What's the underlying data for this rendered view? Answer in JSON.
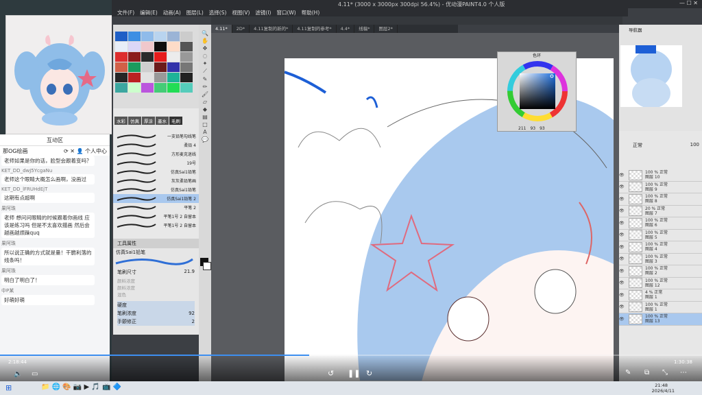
{
  "window_title": "4.11* (3000 x 3000px 300dpi 56.4%)  - 优动漫PAINT4.0 个人版",
  "menu": [
    "文件(F)",
    "编辑(E)",
    "动画(A)",
    "图层(L)",
    "选择(S)",
    "视图(V)",
    "滤镜(I)",
    "窗口(W)",
    "帮助(H)"
  ],
  "doc_tabs": [
    "4.11*",
    "2D*",
    "4.11复制的新的*",
    "4.11复制的参考*",
    "4.4*",
    "线稿*",
    "图层2*"
  ],
  "chat": {
    "title": "互动区",
    "channel": "那OG绘画",
    "personal_center": "个人中心",
    "messages": [
      {
        "user": "",
        "text": "老师如果是你的话，脸型会跟着变吗？"
      },
      {
        "user": "KET_DD_dwJ5YcgaNu",
        "text": "老师这个眼睛大概怎么画啊，没画过"
      },
      {
        "user": "KET_DD_lFRUHdEjT",
        "text": "这期有点超啊"
      },
      {
        "user": "果阿珠",
        "text": "老师 想问问眼睛的时候跟着你画线 应该是练习吗 但是不太喜欢描画 然后会越画越烦躁quq"
      },
      {
        "user": "果阿珠",
        "text": "所以说正确的方式就是量！干脆利落的线条吗！"
      },
      {
        "user": "果阿珠",
        "text": "明白了明白了！"
      },
      {
        "user": "中P某",
        "text": "好萌好萌"
      }
    ]
  },
  "subtool": {
    "tabs": [
      "水彩",
      "仿真",
      "厚涂",
      "墨水",
      "毛刷"
    ],
    "header": "一般铅笔GB",
    "brushes": [
      "一支铅笔勾线笔",
      "柔铅 4",
      "方形麦克迷线",
      "19号",
      "仿真Sai1铅笔",
      "灰灰柔铅笔画",
      "仿真Sai1铅笔",
      "仿真Sai1铅笔 2",
      "平笔 2",
      "平笔1号 2 自留本",
      "平笔1号 2 自留本"
    ]
  },
  "tool_property": {
    "title": "工具属性",
    "brush": "仿真Sai1铅笔",
    "brush_size_label": "笔刷尺寸",
    "brush_size": "21.9",
    "rows": [
      "颜料浓度",
      "颜料浓度",
      "混色",
      "硬度",
      "笔刷浓度",
      "手颤修正"
    ],
    "brush_density": "92",
    "stabilization": "2"
  },
  "color_wheel": {
    "title": "色环",
    "h": "211",
    "s": "93",
    "v": "93"
  },
  "nav_title": "导航器",
  "layers": {
    "blend": "正常",
    "opacity": "100",
    "rows": [
      {
        "label": "100 % 正常",
        "name": "图层 10"
      },
      {
        "label": "100 % 正常",
        "name": "图层 9"
      },
      {
        "label": "100 % 正常",
        "name": "图层 8"
      },
      {
        "label": "20 % 正常",
        "name": "图层 7"
      },
      {
        "label": "100 % 正常",
        "name": "图层 6"
      },
      {
        "label": "100 % 正常",
        "name": "图层 5"
      },
      {
        "label": "100 % 正常",
        "name": "图层 4"
      },
      {
        "label": "100 % 正常",
        "name": "图层 3"
      },
      {
        "label": "100 % 正常",
        "name": "图层 2"
      },
      {
        "label": "100 % 正常",
        "name": "图层 12"
      },
      {
        "label": "4 % 正常",
        "name": "图层 1"
      },
      {
        "label": "100 % 正常",
        "name": "图层 1"
      },
      {
        "label": "100 % 正常",
        "name": "图层 13"
      }
    ]
  },
  "player": {
    "current": "2:18:44",
    "total": "1:30:38",
    "progress": 0.44
  },
  "taskbar": {
    "time": "21:48",
    "date": "2026/4/11"
  },
  "colors": {
    "accent": "#3d8ff0",
    "hair": "#a9c9ee"
  }
}
